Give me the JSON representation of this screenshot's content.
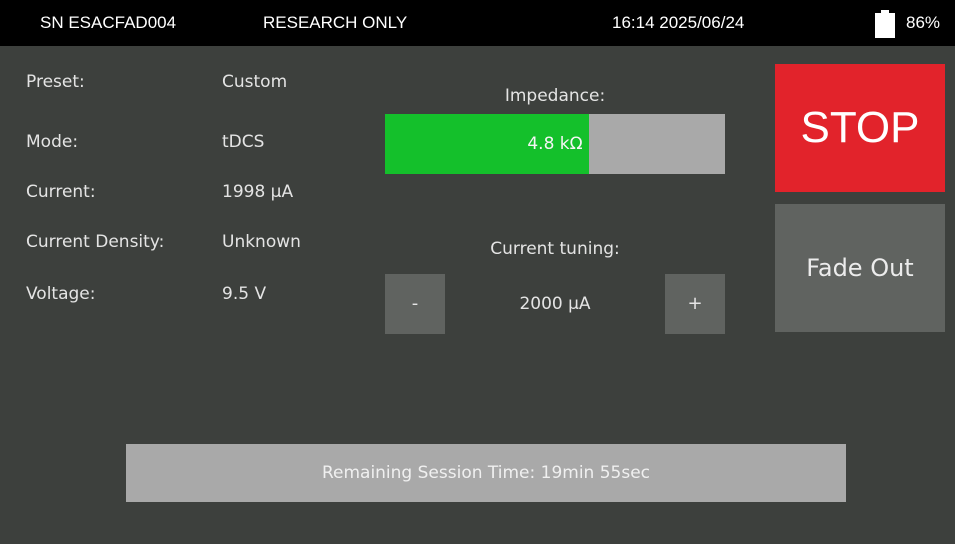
{
  "status_bar": {
    "serial": "SN ESACFAD004",
    "mode_label": "RESEARCH ONLY",
    "datetime": "16:14 2025/06/24",
    "battery_percent": "86%",
    "battery_icon": "battery-icon"
  },
  "info": {
    "preset_label": "Preset:",
    "preset_value": "Custom",
    "mode_label": "Mode:",
    "mode_value": "tDCS",
    "current_label": "Current:",
    "current_value": "1998 µA",
    "density_label": "Current Density:",
    "density_value": "Unknown",
    "voltage_label": "Voltage:",
    "voltage_value": "9.5 V"
  },
  "impedance": {
    "title": "Impedance:",
    "value_text": "4.8 kΩ",
    "fill_fraction": 0.6,
    "fill_color": "#14c02b"
  },
  "tuning": {
    "title": "Current tuning:",
    "minus_label": "-",
    "plus_label": "+",
    "value_text": "2000 µA"
  },
  "actions": {
    "stop_label": "STOP",
    "stop_color": "#e2232b",
    "fade_label": "Fade Out"
  },
  "session": {
    "remaining_text": "Remaining Session Time: 19min 55sec"
  }
}
